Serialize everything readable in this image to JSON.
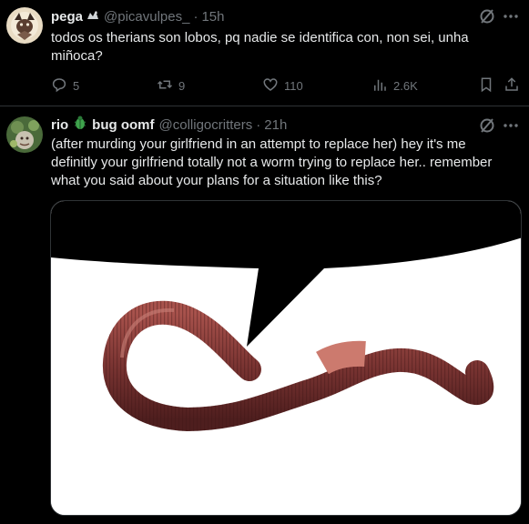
{
  "tweets": [
    {
      "display_name": "pega",
      "handle": "@picavulpes_",
      "separator": "·",
      "time": "15h",
      "text": "todos os therians son lobos, pq nadie se identifica con, non sei, unha miñoca?",
      "actions": {
        "replies": "5",
        "retweets": "9",
        "likes": "110",
        "views": "2.6K"
      }
    },
    {
      "display_name": "rio",
      "display_name_suffix": "bug oomf",
      "handle": "@colligocritters",
      "separator": "·",
      "time": "21h",
      "text": "(after murding your girlfriend in an attempt to replace her) hey it's me definitly your girlfriend totally not a worm trying to replace her.. remember what you said about your plans for a situation like this?"
    }
  ],
  "colors": {
    "background": "#000000",
    "text_primary": "#e7e9ea",
    "text_secondary": "#71767b",
    "divider": "#2f3336"
  },
  "icons": [
    "reply-icon",
    "retweet-icon",
    "like-icon",
    "views-icon",
    "bookmark-icon",
    "share-icon",
    "grok-icon",
    "more-icon",
    "fox-emoji-icon",
    "bug-emoji-icon"
  ]
}
